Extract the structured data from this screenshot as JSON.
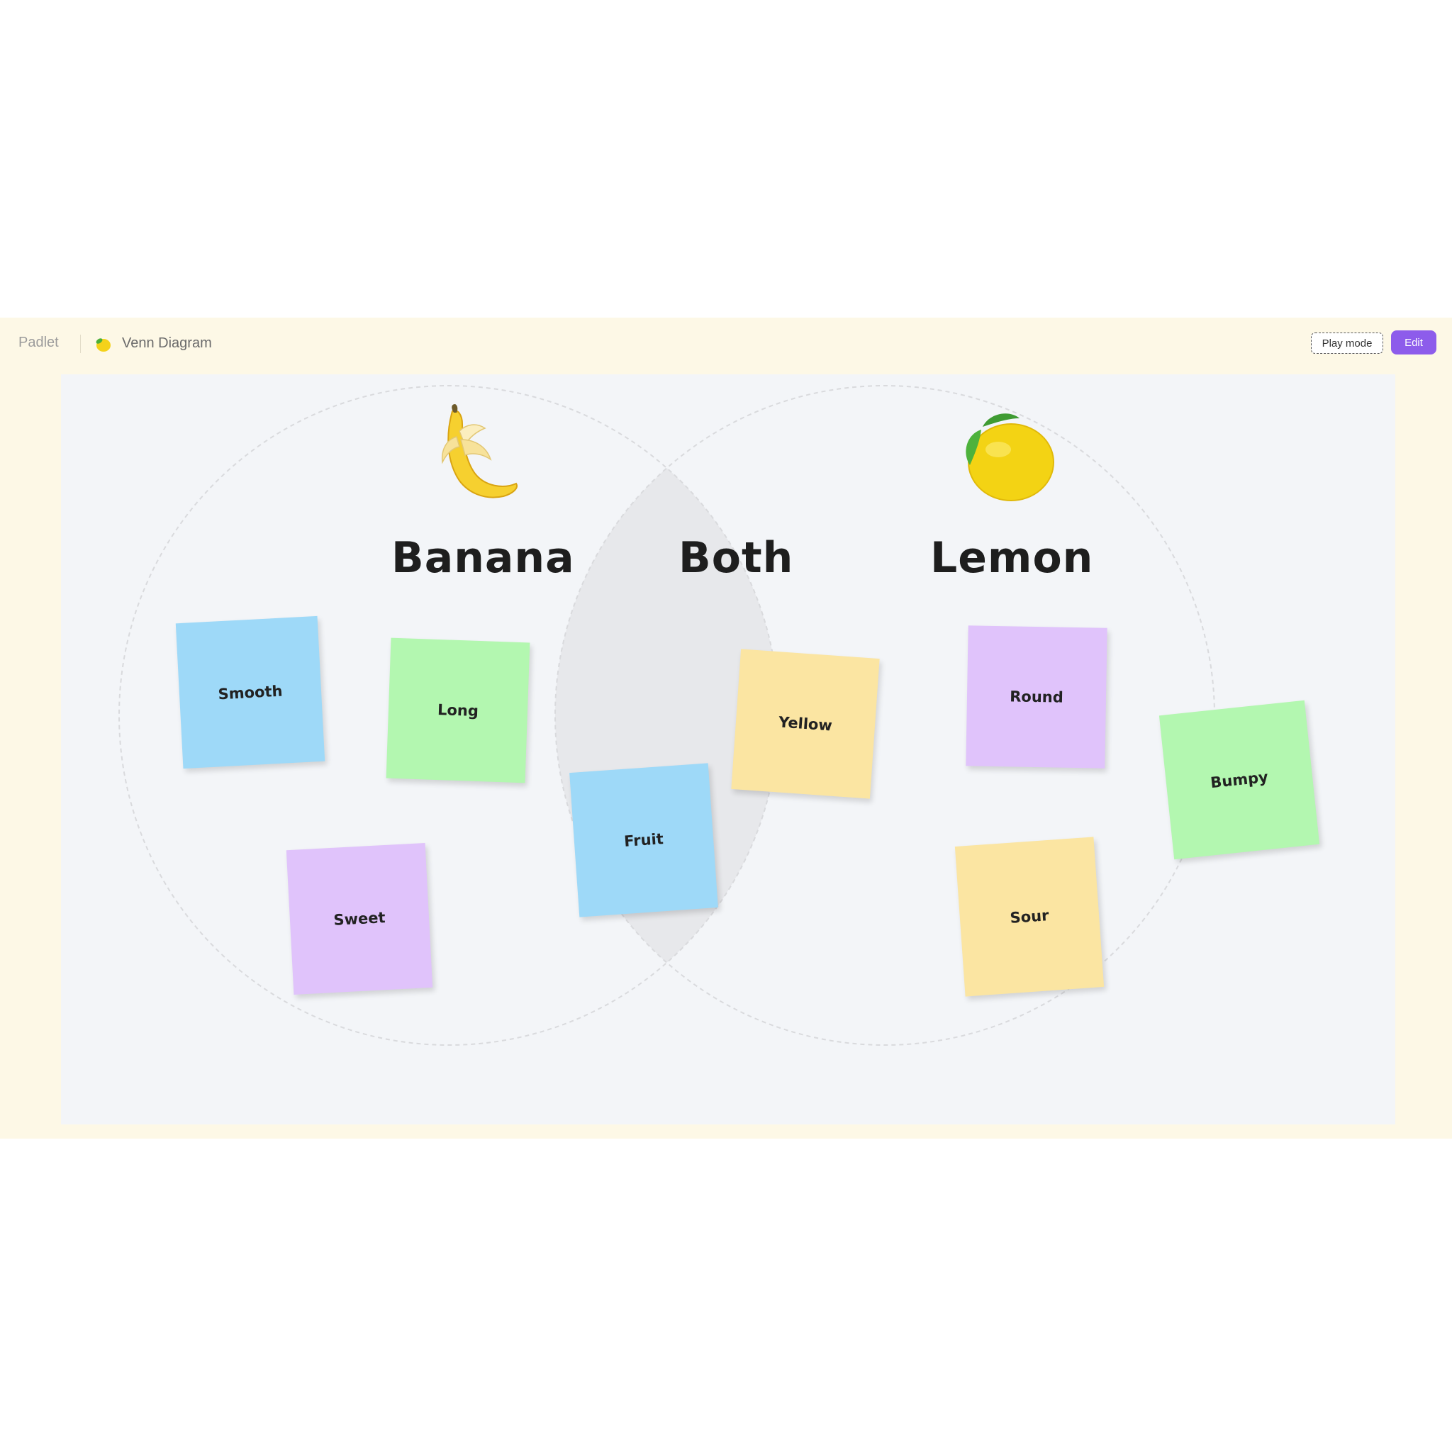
{
  "topbar": {
    "brand": "Padlet",
    "board_title": "Venn Diagram",
    "play_mode_label": "Play mode",
    "edit_label": "Edit"
  },
  "board": {
    "headings": {
      "left": "Banana",
      "middle": "Both",
      "right": "Lemon"
    },
    "notes": [
      {
        "text": "Smooth",
        "color": "#9ed9f8"
      },
      {
        "text": "Long",
        "color": "#b3f7b0"
      },
      {
        "text": "Sweet",
        "color": "#e0c3fb"
      },
      {
        "text": "Yellow",
        "color": "#fbe5a2"
      },
      {
        "text": "Fruit",
        "color": "#9ed9f8"
      },
      {
        "text": "Round",
        "color": "#e0c3fb"
      },
      {
        "text": "Bumpy",
        "color": "#b3f7b0"
      },
      {
        "text": "Sour",
        "color": "#fbe5a2"
      }
    ]
  },
  "colors": {
    "app_background": "#fdf8e6",
    "canvas_background": "#f3f5f8",
    "overlap_fill": "#e7e8eb",
    "edit_button": "#8d5ceb"
  },
  "icons": {
    "board_icon": "lemon-icon",
    "left_image": "banana-icon",
    "right_image": "lemon-icon"
  }
}
